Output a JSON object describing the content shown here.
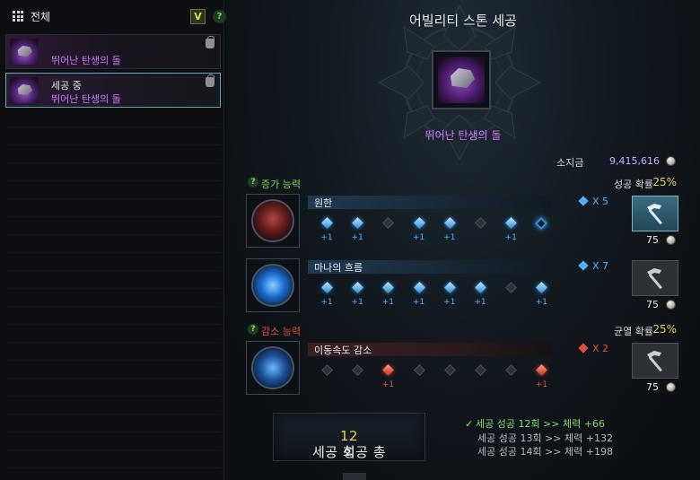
{
  "left": {
    "filter_label": "전체",
    "dropdown_glyph": "V",
    "help_glyph": "?",
    "stones": [
      {
        "line1": "",
        "line2": "뛰어난 탄생의 돌",
        "active": false
      },
      {
        "line1": "세공 중",
        "line2": "뛰어난 탄생의 돌",
        "active": true
      }
    ]
  },
  "title": "어빌리티 스톤 세공",
  "item_name": "뛰어난 탄생의 돌",
  "gold": {
    "label": "소지금",
    "value": "9,415,616"
  },
  "increase": {
    "help": "?",
    "label": "증가 능력",
    "prob_label": "성공 확률",
    "prob_value": "25%",
    "color": "#7bd35a"
  },
  "decrease": {
    "help": "?",
    "label": "감소 능력",
    "prob_label": "균열 확률",
    "prob_value": "25%",
    "color": "#e2503c"
  },
  "abilities": [
    {
      "name": "원한",
      "count": "X 5",
      "nodes": [
        "blue",
        "blue",
        "empty",
        "blue",
        "blue",
        "empty",
        "blue",
        "ring"
      ],
      "plus": [
        "+1",
        "+1",
        "",
        "+1",
        "+1",
        "",
        "+1",
        ""
      ],
      "cost": "75",
      "button_active": true
    },
    {
      "name": "마나의 흐름",
      "count": "X 7",
      "nodes": [
        "blue",
        "blue",
        "blue",
        "blue",
        "blue",
        "blue",
        "empty",
        "blue"
      ],
      "plus": [
        "+1",
        "+1",
        "+1",
        "+1",
        "+1",
        "+1",
        "",
        "+1"
      ],
      "cost": "75",
      "button_active": false
    },
    {
      "name": "이동속도 감소",
      "count": "X 2",
      "nodes": [
        "empty",
        "empty",
        "red",
        "empty",
        "empty",
        "empty",
        "empty",
        "red"
      ],
      "plus": [
        "",
        "",
        "+1",
        "",
        "",
        "",
        "",
        "+1"
      ],
      "cost": "75",
      "button_active": false
    }
  ],
  "bottom": {
    "prefix": "세공 성공 총 ",
    "number": "12",
    "suffix": "회"
  },
  "history": [
    {
      "check": "✓",
      "text": "세공 성공 12회 >> 체력 +66"
    },
    {
      "check": "",
      "text": "세공 성공 13회 >> 체력 +132"
    },
    {
      "check": "",
      "text": "세공 성공 14회 >> 체력 +198"
    }
  ]
}
